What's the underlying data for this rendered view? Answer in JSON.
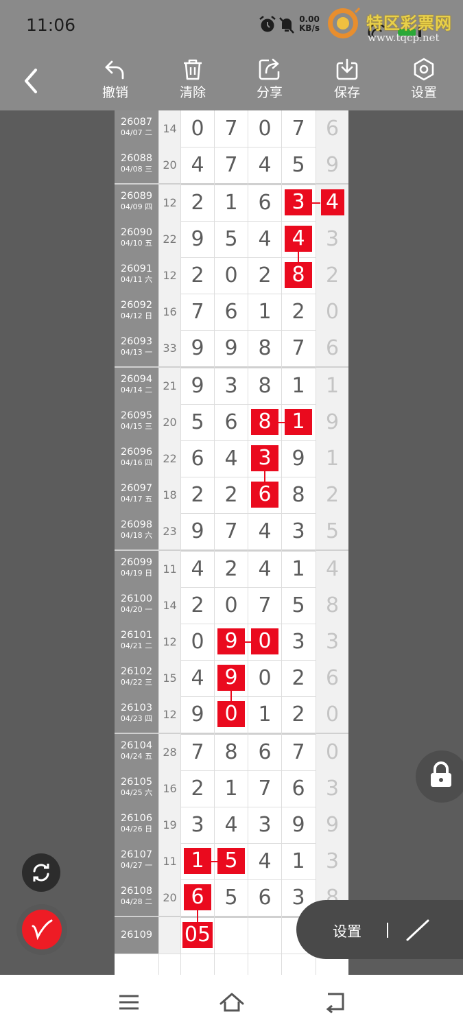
{
  "status_bar": {
    "time": "11:06",
    "net_speed_value": "0.00",
    "net_speed_unit": "KB/s",
    "watermark_text": "特区彩票网",
    "watermark_url": "www.tqcp.net"
  },
  "toolbar": {
    "undo_label": "撤销",
    "clear_label": "清除",
    "share_label": "分享",
    "save_label": "保存",
    "settings_label": "设置"
  },
  "table": {
    "rows": [
      {
        "period": "26087",
        "date": "04/07 二",
        "sum": "14",
        "digits": [
          "0",
          "7",
          "0",
          "7"
        ],
        "tail": "6"
      },
      {
        "period": "26088",
        "date": "04/08 三",
        "sum": "20",
        "digits": [
          "4",
          "7",
          "4",
          "5"
        ],
        "tail": "9"
      },
      {
        "period": "26089",
        "date": "04/09 四",
        "sum": "12",
        "digits": [
          "2",
          "1",
          "6",
          "3"
        ],
        "tail": "4"
      },
      {
        "period": "26090",
        "date": "04/10 五",
        "sum": "22",
        "digits": [
          "9",
          "5",
          "4",
          "4"
        ],
        "tail": "3"
      },
      {
        "period": "26091",
        "date": "04/11 六",
        "sum": "12",
        "digits": [
          "2",
          "0",
          "2",
          "8"
        ],
        "tail": "2"
      },
      {
        "period": "26092",
        "date": "04/12 日",
        "sum": "16",
        "digits": [
          "7",
          "6",
          "1",
          "2"
        ],
        "tail": "0"
      },
      {
        "period": "26093",
        "date": "04/13 一",
        "sum": "33",
        "digits": [
          "9",
          "9",
          "8",
          "7"
        ],
        "tail": "6"
      },
      {
        "period": "26094",
        "date": "04/14 二",
        "sum": "21",
        "digits": [
          "9",
          "3",
          "8",
          "1"
        ],
        "tail": "1"
      },
      {
        "period": "26095",
        "date": "04/15 三",
        "sum": "20",
        "digits": [
          "5",
          "6",
          "8",
          "1"
        ],
        "tail": "9"
      },
      {
        "period": "26096",
        "date": "04/16 四",
        "sum": "22",
        "digits": [
          "6",
          "4",
          "3",
          "9"
        ],
        "tail": "1"
      },
      {
        "period": "26097",
        "date": "04/17 五",
        "sum": "18",
        "digits": [
          "2",
          "2",
          "6",
          "8"
        ],
        "tail": "2"
      },
      {
        "period": "26098",
        "date": "04/18 六",
        "sum": "23",
        "digits": [
          "9",
          "7",
          "4",
          "3"
        ],
        "tail": "5"
      },
      {
        "period": "26099",
        "date": "04/19 日",
        "sum": "11",
        "digits": [
          "4",
          "2",
          "4",
          "1"
        ],
        "tail": "4"
      },
      {
        "period": "26100",
        "date": "04/20 一",
        "sum": "14",
        "digits": [
          "2",
          "0",
          "7",
          "5"
        ],
        "tail": "8"
      },
      {
        "period": "26101",
        "date": "04/21 二",
        "sum": "12",
        "digits": [
          "0",
          "9",
          "0",
          "3"
        ],
        "tail": "3"
      },
      {
        "period": "26102",
        "date": "04/22 三",
        "sum": "15",
        "digits": [
          "4",
          "9",
          "0",
          "2"
        ],
        "tail": "6"
      },
      {
        "period": "26103",
        "date": "04/23 四",
        "sum": "12",
        "digits": [
          "9",
          "0",
          "1",
          "2"
        ],
        "tail": "0"
      },
      {
        "period": "26104",
        "date": "04/24 五",
        "sum": "28",
        "digits": [
          "7",
          "8",
          "6",
          "7"
        ],
        "tail": "0"
      },
      {
        "period": "26105",
        "date": "04/25 六",
        "sum": "16",
        "digits": [
          "2",
          "1",
          "7",
          "6"
        ],
        "tail": "3"
      },
      {
        "period": "26106",
        "date": "04/26 日",
        "sum": "19",
        "digits": [
          "3",
          "4",
          "3",
          "9"
        ],
        "tail": "9"
      },
      {
        "period": "26107",
        "date": "04/27 一",
        "sum": "11",
        "digits": [
          "1",
          "5",
          "4",
          "1"
        ],
        "tail": "3"
      },
      {
        "period": "26108",
        "date": "04/28 二",
        "sum": "20",
        "digits": [
          "6",
          "5",
          "6",
          "3"
        ],
        "tail": "8"
      },
      {
        "period": "26109",
        "date": "",
        "sum": "",
        "digits": [
          "05",
          "",
          "",
          ""
        ],
        "tail": ""
      }
    ]
  },
  "overlay": {
    "settings_label": "设置"
  }
}
